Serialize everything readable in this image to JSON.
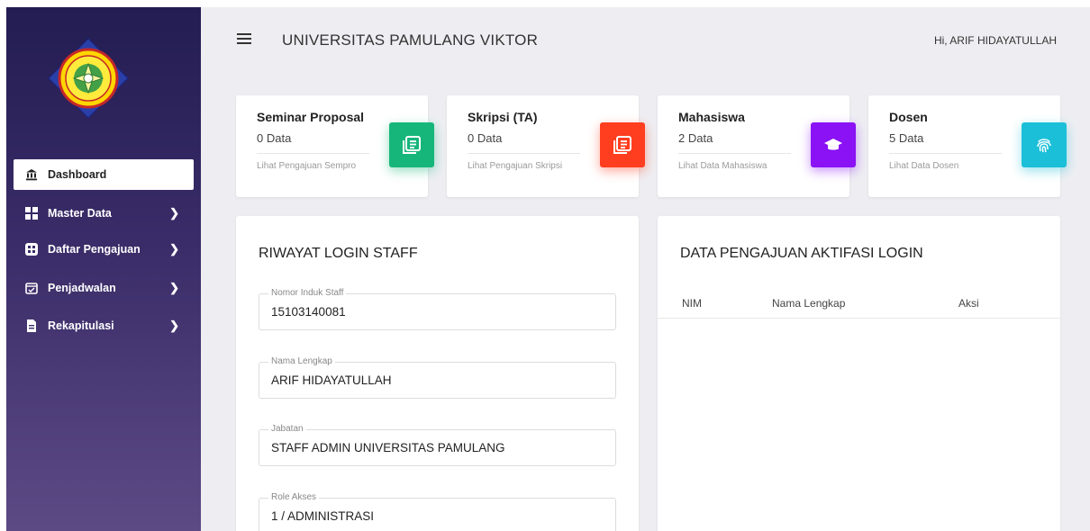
{
  "app": {
    "title": "UNIVERSITAS PAMULANG VIKTOR",
    "greeting": "Hi, ARIF HIDAYATULLAH"
  },
  "sidebar": {
    "items": [
      {
        "label": "Dashboard",
        "icon": "bank-icon",
        "active": true
      },
      {
        "label": "Master Data",
        "icon": "grid-icon",
        "active": false
      },
      {
        "label": "Daftar Pengajuan",
        "icon": "apps-icon",
        "active": false
      },
      {
        "label": "Penjadwalan",
        "icon": "calendar-check-icon",
        "active": false
      },
      {
        "label": "Rekapitulasi",
        "icon": "file-icon",
        "active": false
      }
    ]
  },
  "stats": [
    {
      "title": "Seminar Proposal",
      "value": "0 Data",
      "link": "Lihat Pengajuan Sempro",
      "icon": "document-list-icon",
      "color": "#16b67a"
    },
    {
      "title": "Skripsi (TA)",
      "value": "0 Data",
      "link": "Lihat Pengajuan Skripsi",
      "icon": "document-list-icon",
      "color": "#ff3d1f"
    },
    {
      "title": "Mahasiswa",
      "value": "2 Data",
      "link": "Lihat Data Mahasiswa",
      "icon": "graduation-cap-icon",
      "color": "#8a12f5"
    },
    {
      "title": "Dosen",
      "value": "5 Data",
      "link": "Lihat Data Dosen",
      "icon": "fingerprint-icon",
      "color": "#1bbfd8"
    }
  ],
  "login_history": {
    "title": "RIWAYAT LOGIN STAFF",
    "fields": [
      {
        "label": "Nomor Induk Staff",
        "value": "15103140081"
      },
      {
        "label": "Nama Lengkap",
        "value": "ARIF HIDAYATULLAH"
      },
      {
        "label": "Jabatan",
        "value": "STAFF ADMIN UNIVERSITAS PAMULANG"
      },
      {
        "label": "Role Akses",
        "value": "1 / ADMINISTRASI"
      }
    ]
  },
  "activation": {
    "title": "DATA PENGAJUAN AKTIFASI LOGIN",
    "columns": [
      "NIM",
      "Nama Lengkap",
      "Aksi"
    ],
    "rows": []
  }
}
